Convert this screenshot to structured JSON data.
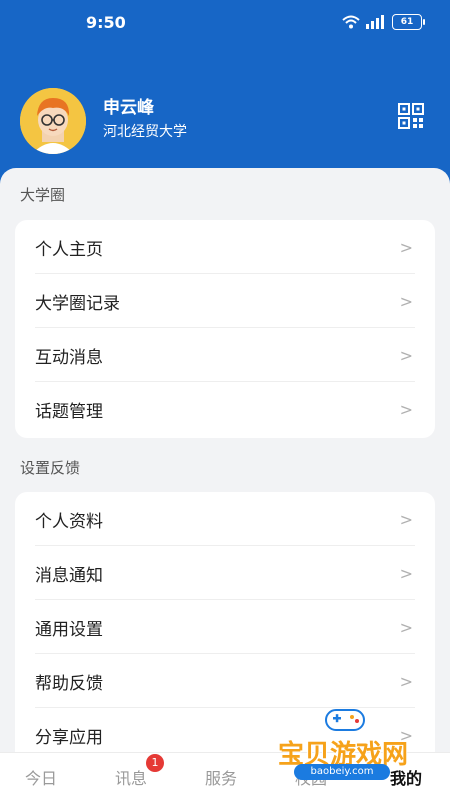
{
  "status_bar": {
    "time": "9:50",
    "battery": "61"
  },
  "profile": {
    "name": "申云峰",
    "school": "河北经贸大学"
  },
  "sections": [
    {
      "title": "大学圈",
      "items": [
        "个人主页",
        "大学圈记录",
        "互动消息",
        "话题管理"
      ]
    },
    {
      "title": "设置反馈",
      "items": [
        "个人资料",
        "消息通知",
        "通用设置",
        "帮助反馈",
        "分享应用"
      ]
    }
  ],
  "chevron": ">",
  "tabbar": {
    "items": [
      "今日",
      "讯息",
      "服务",
      "校园",
      "我的"
    ],
    "active": "我的",
    "badge": "1"
  },
  "watermark": {
    "text": "宝贝游戏网",
    "url": "baobeiy.com"
  },
  "colors": {
    "brand": "#1766c6",
    "badge": "#e53935"
  }
}
